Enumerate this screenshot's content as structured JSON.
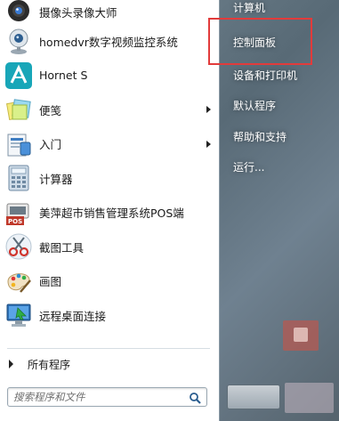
{
  "left_items": [
    {
      "name": "webcam-recorder",
      "label": "摄像头录像大师",
      "icon": "webcam-icon",
      "submenu": false
    },
    {
      "name": "homedvr",
      "label": "homedvr数字视频监控系统",
      "icon": "camera-icon",
      "submenu": false
    },
    {
      "name": "hornet-s",
      "label": "Hornet S",
      "icon": "hornet-icon",
      "submenu": false
    },
    {
      "name": "sticky-notes",
      "label": "便笺",
      "icon": "sticky-notes-icon",
      "submenu": true
    },
    {
      "name": "getting-started",
      "label": "入门",
      "icon": "getting-started-icon",
      "submenu": true
    },
    {
      "name": "calculator",
      "label": "计算器",
      "icon": "calculator-icon",
      "submenu": false
    },
    {
      "name": "pos-system",
      "label": "美萍超市销售管理系统POS端",
      "icon": "pos-icon",
      "submenu": false
    },
    {
      "name": "snipping-tool",
      "label": "截图工具",
      "icon": "scissors-icon",
      "submenu": false
    },
    {
      "name": "paint",
      "label": "画图",
      "icon": "paint-icon",
      "submenu": false
    },
    {
      "name": "remote-desktop",
      "label": "远程桌面连接",
      "icon": "remote-desktop-icon",
      "submenu": false
    }
  ],
  "all_programs_label": "所有程序",
  "search": {
    "placeholder": "搜索程序和文件"
  },
  "right_items": [
    {
      "name": "computer",
      "label": "计算机"
    },
    {
      "name": "control-panel",
      "label": "控制面板"
    },
    {
      "name": "devices-printers",
      "label": "设备和打印机"
    },
    {
      "name": "default-programs",
      "label": "默认程序"
    },
    {
      "name": "help-support",
      "label": "帮助和支持"
    },
    {
      "name": "run",
      "label": "运行..."
    }
  ],
  "colors": {
    "highlight_border": "#e23b3b",
    "right_text": "#ffffff"
  }
}
